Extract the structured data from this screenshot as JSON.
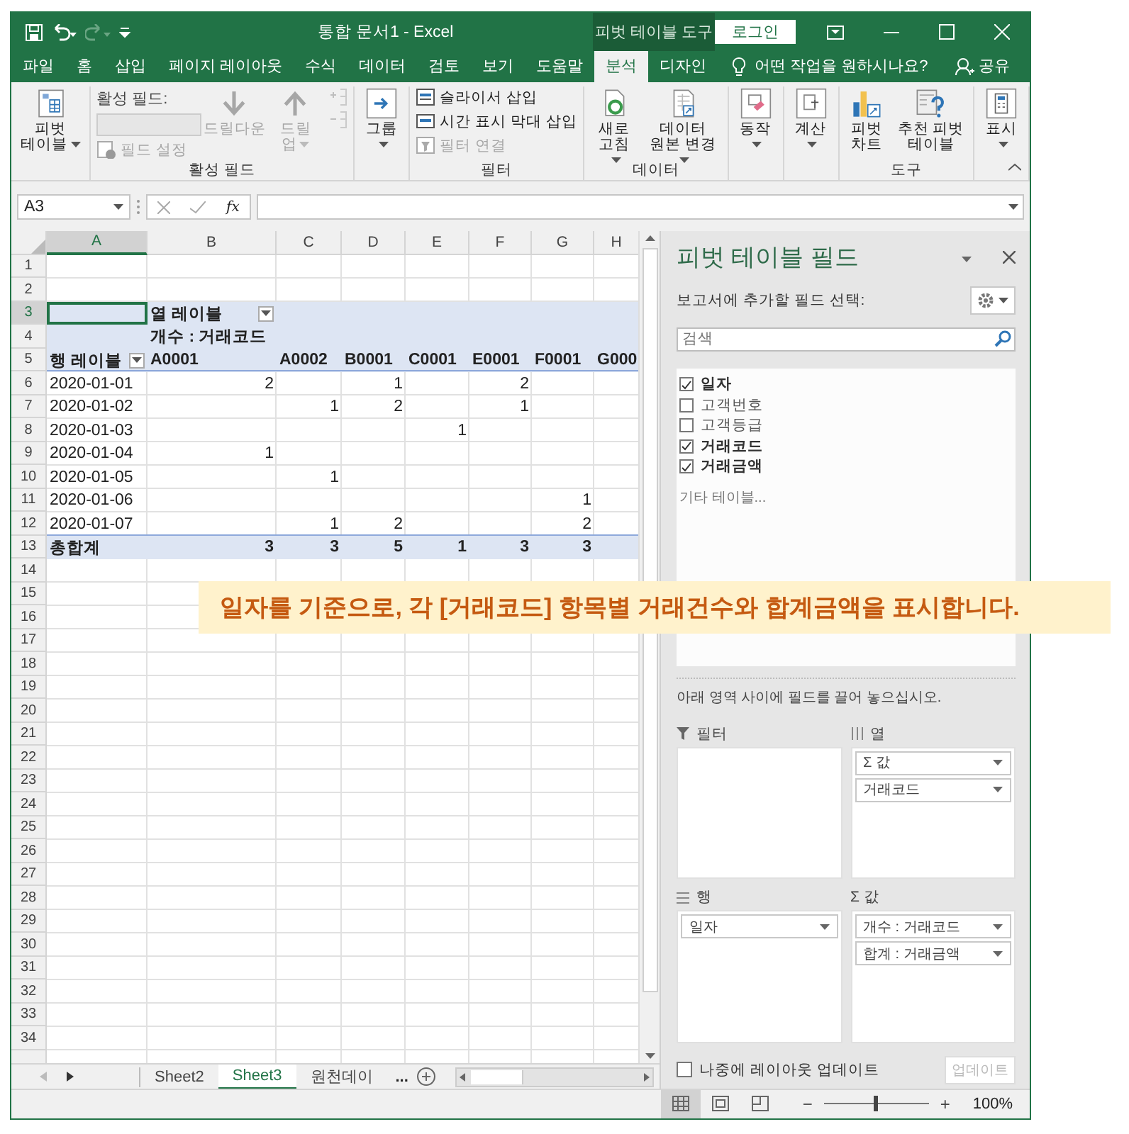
{
  "title_bar": {
    "title": "통합 문서1 - Excel",
    "context_tab": "피벗 테이블 도구",
    "sign_in": "로그인"
  },
  "tabs": [
    {
      "label": "파일",
      "selected": false
    },
    {
      "label": "홈",
      "selected": false
    },
    {
      "label": "삽입",
      "selected": false
    },
    {
      "label": "페이지 레이아웃",
      "selected": false
    },
    {
      "label": "수식",
      "selected": false
    },
    {
      "label": "데이터",
      "selected": false
    },
    {
      "label": "검토",
      "selected": false
    },
    {
      "label": "보기",
      "selected": false
    },
    {
      "label": "도움말",
      "selected": false
    },
    {
      "label": "분석",
      "selected": true
    },
    {
      "label": "디자인",
      "selected": false
    }
  ],
  "tell_me": "어떤 작업을 원하시나요?",
  "share": "공유",
  "ribbon": {
    "groups": [
      {
        "items": [
          {
            "kind": "pivot_table",
            "label": "피벗 테이블",
            "disabled": false,
            "dropdown": true
          }
        ]
      },
      {
        "label": "활성 필드",
        "items": [
          {
            "kind": "active_field",
            "label": "활성 필드:",
            "disabled": true,
            "dropdown": false
          },
          {
            "kind": "field_settings",
            "label": "필드 설정",
            "disabled": true,
            "dropdown": false
          },
          {
            "kind": "drill_down",
            "label": "드릴다운",
            "disabled": true,
            "dropdown": false
          },
          {
            "kind": "drill_up",
            "label": "드릴 업",
            "disabled": true,
            "dropdown": true
          },
          {
            "kind": "expand",
            "disabled": true,
            "dropdown": false
          },
          {
            "kind": "collapse",
            "disabled": true,
            "dropdown": false
          }
        ]
      },
      {
        "items": [
          {
            "kind": "group",
            "label": "그룹",
            "disabled": false,
            "dropdown": true
          }
        ]
      },
      {
        "label": "필터",
        "items": [
          {
            "kind": "slicer",
            "label": "슬라이서 삽입",
            "disabled": false,
            "dropdown": false
          },
          {
            "kind": "timeline",
            "label": "시간 표시 막대 삽입",
            "disabled": false,
            "dropdown": false
          },
          {
            "kind": "filter_connections",
            "label": "필터 연결",
            "disabled": true,
            "dropdown": false
          }
        ]
      },
      {
        "label": "데이터",
        "items": [
          {
            "kind": "refresh",
            "label": "새로 고침",
            "disabled": false,
            "dropdown": true
          },
          {
            "kind": "change_source",
            "label": "데이터 원본 변경",
            "disabled": false,
            "dropdown": true
          }
        ]
      },
      {
        "items": [
          {
            "kind": "actions",
            "label": "동작",
            "disabled": false,
            "dropdown": true
          }
        ]
      },
      {
        "items": [
          {
            "kind": "calculations",
            "label": "계산",
            "disabled": false,
            "dropdown": true
          }
        ]
      },
      {
        "label": "도구",
        "items": [
          {
            "kind": "pivot_chart",
            "label": "피벗 차트",
            "disabled": false,
            "dropdown": false
          },
          {
            "kind": "recommended",
            "label": "추천 피벗 테이블",
            "disabled": false,
            "dropdown": false
          }
        ]
      },
      {
        "items": [
          {
            "kind": "show",
            "label": "표시",
            "disabled": false,
            "dropdown": true
          }
        ]
      }
    ]
  },
  "formula_bar": {
    "name_box": "A3",
    "function_symbol": "fx"
  },
  "sheet": {
    "columns": [
      {
        "label": "A",
        "selected": true
      },
      {
        "label": "B",
        "selected": false
      },
      {
        "label": "C",
        "selected": false
      },
      {
        "label": "D",
        "selected": false
      },
      {
        "label": "E",
        "selected": false
      },
      {
        "label": "F",
        "selected": false
      },
      {
        "label": "G",
        "selected": false
      },
      {
        "label": "H",
        "selected": false
      }
    ],
    "row_headers": [
      {
        "label": "1",
        "selected": false
      },
      {
        "label": "2",
        "selected": false
      },
      {
        "label": "3",
        "selected": true
      },
      {
        "label": "4",
        "selected": false
      },
      {
        "label": "5",
        "selected": false
      },
      {
        "label": "6",
        "selected": false
      },
      {
        "label": "7",
        "selected": false
      },
      {
        "label": "8",
        "selected": false
      },
      {
        "label": "9",
        "selected": false
      },
      {
        "label": "10",
        "selected": false
      },
      {
        "label": "11",
        "selected": false
      },
      {
        "label": "12",
        "selected": false
      },
      {
        "label": "13",
        "selected": false
      },
      {
        "label": "14",
        "selected": false
      },
      {
        "label": "15",
        "selected": false
      },
      {
        "label": "16",
        "selected": false
      },
      {
        "label": "17",
        "selected": false
      },
      {
        "label": "18",
        "selected": false
      },
      {
        "label": "19",
        "selected": false
      },
      {
        "label": "20",
        "selected": false
      },
      {
        "label": "21",
        "selected": false
      },
      {
        "label": "22",
        "selected": false
      },
      {
        "label": "23",
        "selected": false
      },
      {
        "label": "24",
        "selected": false
      },
      {
        "label": "25",
        "selected": false
      },
      {
        "label": "26",
        "selected": false
      },
      {
        "label": "27",
        "selected": false
      },
      {
        "label": "28",
        "selected": false
      },
      {
        "label": "29",
        "selected": false
      },
      {
        "label": "30",
        "selected": false
      },
      {
        "label": "31",
        "selected": false
      },
      {
        "label": "32",
        "selected": false
      },
      {
        "label": "33",
        "selected": false
      },
      {
        "label": "34",
        "selected": false
      }
    ],
    "pivot": {
      "column_label": "열 레이블",
      "value_label": "개수 : 거래코드",
      "row_label": "행 레이블",
      "column_headers": [
        "A0001",
        "A0002",
        "B0001",
        "C0001",
        "E0001",
        "F0001",
        "G000"
      ],
      "rows": [
        {
          "label": "2020-01-01",
          "values": {
            "B": "2",
            "D": "1",
            "F": "2"
          }
        },
        {
          "label": "2020-01-02",
          "values": {
            "C": "1",
            "D": "2",
            "F": "1"
          }
        },
        {
          "label": "2020-01-03",
          "values": {
            "E": "1"
          }
        },
        {
          "label": "2020-01-04",
          "values": {
            "B": "1"
          }
        },
        {
          "label": "2020-01-05",
          "values": {
            "C": "1"
          }
        },
        {
          "label": "2020-01-06",
          "values": {
            "G": "1"
          }
        },
        {
          "label": "2020-01-07",
          "values": {
            "C": "1",
            "D": "2",
            "G": "2"
          }
        }
      ],
      "total": {
        "label": "총합계",
        "values": {
          "B": "3",
          "C": "3",
          "D": "5",
          "E": "1",
          "F": "3",
          "G": "3"
        }
      }
    }
  },
  "sheet_tabs": [
    {
      "label": "Sheet2",
      "selected": false
    },
    {
      "label": "Sheet3",
      "selected": true
    },
    {
      "label": "원천데이",
      "selected": false
    }
  ],
  "tab_overflow": "...",
  "field_pane": {
    "title": "피벗 테이블 필드",
    "prompt": "보고서에 추가할 필드 선택:",
    "search": {
      "placeholder": "검색"
    },
    "fields": [
      {
        "label": "일자",
        "checked": true
      },
      {
        "label": "고객번호",
        "checked": false
      },
      {
        "label": "고객등급",
        "checked": false
      },
      {
        "label": "거래코드",
        "checked": true
      },
      {
        "label": "거래금액",
        "checked": true
      }
    ],
    "more_tables": "기타 테이블...",
    "drag_hint": "아래 영역 사이에 필드를 끌어 놓으십시오.",
    "areas": [
      {
        "kind": "filter",
        "label": "필터"
      },
      {
        "kind": "columns",
        "label": "열",
        "items": [
          "Σ 값",
          "거래코드"
        ]
      },
      {
        "kind": "rows",
        "label": "행",
        "items": [
          "일자"
        ]
      },
      {
        "kind": "values",
        "label": "Σ 값",
        "items": [
          "개수 : 거래코드",
          "합계 : 거래금액"
        ]
      }
    ],
    "defer": {
      "label": "나중에 레이아웃 업데이트",
      "checked": false
    },
    "update_button": {
      "label": "업데이트",
      "disabled": true
    }
  },
  "status_bar": {
    "views": [
      {
        "kind": "normal",
        "selected": true
      },
      {
        "kind": "page_layout",
        "selected": false
      },
      {
        "kind": "page_break",
        "selected": false
      }
    ],
    "zoom_out": "−",
    "zoom_in": "+",
    "zoom": {
      "level": 0.5,
      "reading": "100%"
    }
  },
  "callout": "일자를 기준으로, 각 [거래코드] 항목별 거래건수와 합계금액을 표시합니다."
}
